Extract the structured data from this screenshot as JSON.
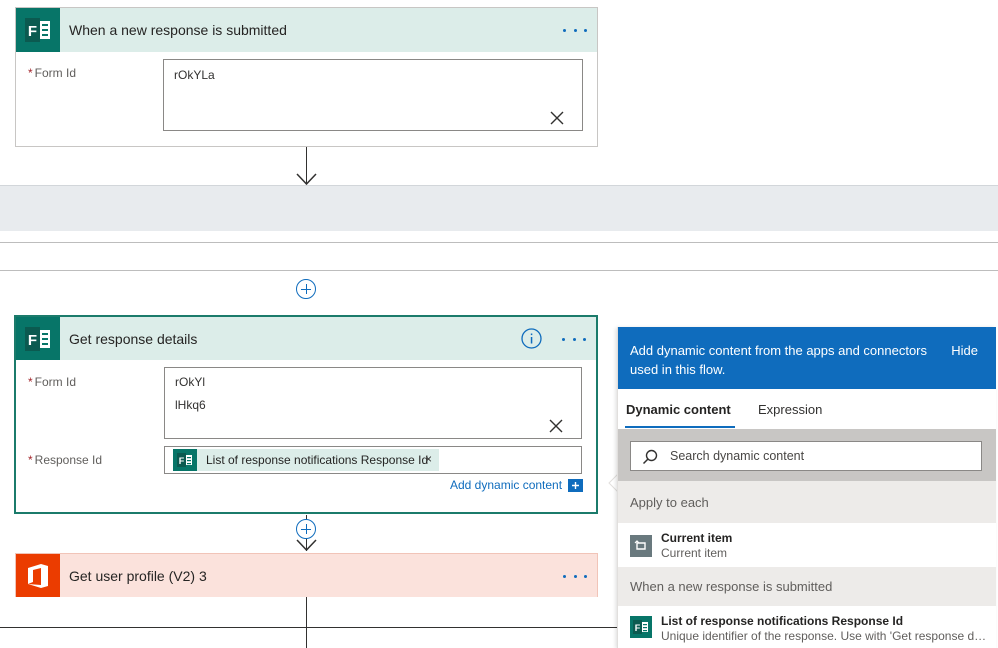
{
  "trigger": {
    "title": "When a new response is submitted",
    "form_id_label": "Form Id",
    "form_id_value": "rOkYLa"
  },
  "get_details": {
    "title": "Get response details",
    "form_id_label": "Form Id",
    "form_id_line1": "rOkYl",
    "form_id_line2": "lHkq6",
    "response_id_label": "Response Id",
    "response_token": "List of response notifications Response Id",
    "token_remove": "×",
    "add_dynamic": "Add dynamic content"
  },
  "user_profile": {
    "title": "Get user profile (V2) 3"
  },
  "dynamic_panel": {
    "description": "Add dynamic content from the apps and connectors used in this flow.",
    "hide_label": "Hide",
    "tabs": [
      "Dynamic content",
      "Expression"
    ],
    "active_tab": "Dynamic content",
    "search_placeholder": "Search dynamic content",
    "sections": [
      {
        "header": "Apply to each",
        "items": [
          {
            "title": "Current item",
            "subtitle": "Current item",
            "icon": "loop-icon"
          }
        ]
      },
      {
        "header": "When a new response is submitted",
        "items": [
          {
            "title": "List of response notifications Response Id",
            "subtitle": "Unique identifier of the response. Use with 'Get response de…",
            "icon": "forms-icon"
          }
        ]
      }
    ]
  },
  "colors": {
    "forms_header": "#dcede9",
    "forms_brand": "#077568",
    "office_header": "#fbe2dc",
    "office_brand": "#eb3c00",
    "accent": "#0f6cbd",
    "selected_border": "#1b7b6b"
  }
}
